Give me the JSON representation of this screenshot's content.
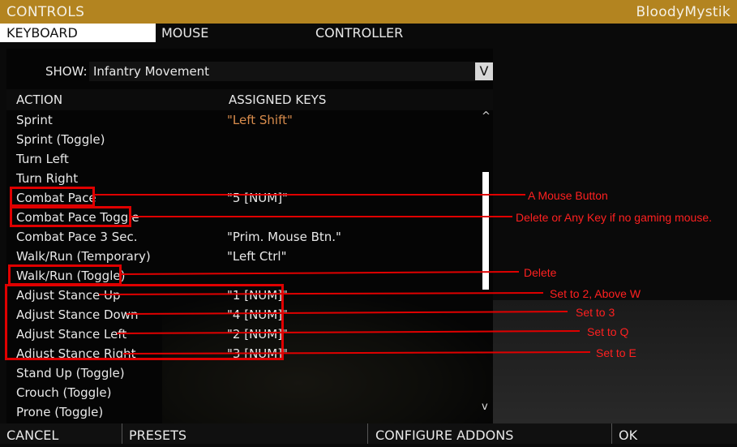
{
  "window": {
    "title": "CONTROLS",
    "profile": "BloodyMystik"
  },
  "tabs": [
    "KEYBOARD",
    "MOUSE",
    "CONTROLLER"
  ],
  "show": {
    "label": "SHOW:",
    "value": "Infantry Movement",
    "dropdown_glyph": "V"
  },
  "table": {
    "col_action": "ACTION",
    "col_keys": "ASSIGNED KEYS",
    "rows": [
      {
        "action": "Sprint",
        "keys": "\"Left Shift\""
      },
      {
        "action": "Sprint (Toggle)",
        "keys": ""
      },
      {
        "action": "Turn Left",
        "keys": ""
      },
      {
        "action": "Turn Right",
        "keys": ""
      },
      {
        "action": "Combat Pace",
        "keys": "\"5 [NUM]\""
      },
      {
        "action": "Combat Pace Toggle",
        "keys": ""
      },
      {
        "action": "Combat Pace 3 Sec.",
        "keys": "\"Prim. Mouse Btn.\""
      },
      {
        "action": "Walk/Run (Temporary)",
        "keys": "\"Left Ctrl\""
      },
      {
        "action": "Walk/Run (Toggle)",
        "keys": ""
      },
      {
        "action": "Adjust Stance Up",
        "keys": "\"1 [NUM]\""
      },
      {
        "action": "Adjust Stance Down",
        "keys": "\"4 [NUM]\""
      },
      {
        "action": "Adjust Stance Left",
        "keys": "\"2 [NUM]\""
      },
      {
        "action": "Adjust Stance Right",
        "keys": "\"3 [NUM]\""
      },
      {
        "action": "Stand Up (Toggle)",
        "keys": ""
      },
      {
        "action": "Crouch (Toggle)",
        "keys": ""
      },
      {
        "action": "Prone (Toggle)",
        "keys": ""
      }
    ]
  },
  "scroll": {
    "up": "^",
    "down": "v"
  },
  "annotations": {
    "combat_pace": "A Mouse Button",
    "combat_pace_toggle": "Delete or Any Key if no gaming mouse.",
    "walk_run_toggle": "Delete",
    "stance_up": "Set to 2, Above W",
    "stance_down": "Set to 3",
    "stance_left": "Set to Q",
    "stance_right": "Set to E"
  },
  "footer": {
    "cancel": "CANCEL",
    "presets": "PRESETS",
    "configure_addons": "CONFIGURE ADDONS",
    "ok": "OK"
  },
  "colors": {
    "title_bar": "#b38420",
    "annotation": "#ff2020",
    "highlight_key": "#d88c4c"
  }
}
